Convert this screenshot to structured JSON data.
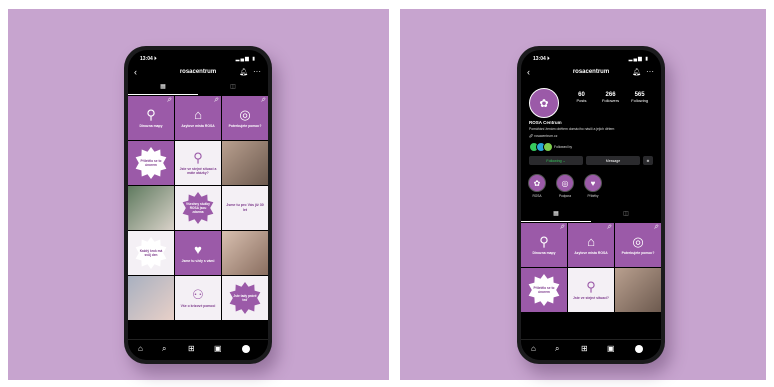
{
  "colors": {
    "background": "#c7a4cf",
    "brand_purple": "#9b5aa8",
    "screen": "#000000"
  },
  "left_phone": {
    "status_time": "13:04 ⏵",
    "username": "rosacentrum",
    "grid": [
      {
        "kind": "icon",
        "icon": "pin-icon",
        "label": "Dinozna mapy"
      },
      {
        "kind": "icon",
        "icon": "house-icon",
        "label": "Azylove mista ROSA"
      },
      {
        "kind": "icon",
        "icon": "lifebuoy-icon",
        "label": "Potrebujete pomoc?"
      },
      {
        "kind": "burst",
        "text": "Přiletělo se to únorem"
      },
      {
        "kind": "icon-light",
        "icon": "pin-icon",
        "label": "Jste ve stejné situaci a máte otázky?"
      },
      {
        "kind": "photo"
      },
      {
        "kind": "photo"
      },
      {
        "kind": "burst-purple",
        "text": "Všechny služby ROSA jsou zdarma"
      },
      {
        "kind": "text",
        "text": "Jsme tu pro Vás již 30 let"
      },
      {
        "kind": "burst-white",
        "text": "Každý krok má svůj den"
      },
      {
        "kind": "icon-heart",
        "icon": "heart-icon",
        "label": "Jsme tu vždy s vámi"
      },
      {
        "kind": "photo"
      },
      {
        "kind": "photo"
      },
      {
        "kind": "people",
        "icon": "people-icon",
        "label": "Vše o krizové pomoci"
      },
      {
        "kind": "burst-purple",
        "text": "Jste tady právě teď"
      }
    ]
  },
  "right_phone": {
    "status_time": "13:04 ⏵",
    "username": "rosacentrum",
    "stats": [
      {
        "n": "60",
        "l": "Posts"
      },
      {
        "n": "266",
        "l": "Followers"
      },
      {
        "n": "565",
        "l": "Following"
      }
    ],
    "name": "ROSA Centrum",
    "bio": "Pomáhání ženám obětem domácího násilí a jejich dětem",
    "link": "rosacentrum.cz",
    "followed_by": "Followed by",
    "buttons": {
      "follow": "Following ⌄",
      "message": "Message"
    },
    "highlights": [
      {
        "icon": "flower-icon",
        "label": "ROSA"
      },
      {
        "icon": "lifebuoy-icon",
        "label": "Podpora"
      },
      {
        "icon": "heart-icon",
        "label": "Příběhy"
      }
    ],
    "grid": [
      {
        "kind": "icon",
        "icon": "pin-icon",
        "label": "Dinozna mapy"
      },
      {
        "kind": "icon",
        "icon": "house-icon",
        "label": "Azylove mista ROSA"
      },
      {
        "kind": "icon",
        "icon": "lifebuoy-icon",
        "label": "Potrebujete pomoc?"
      },
      {
        "kind": "burst",
        "text": "Přiletělo se to únorem"
      },
      {
        "kind": "icon-light",
        "icon": "pin-icon",
        "label": "Jste ve stejné situaci?"
      },
      {
        "kind": "photo"
      }
    ]
  }
}
